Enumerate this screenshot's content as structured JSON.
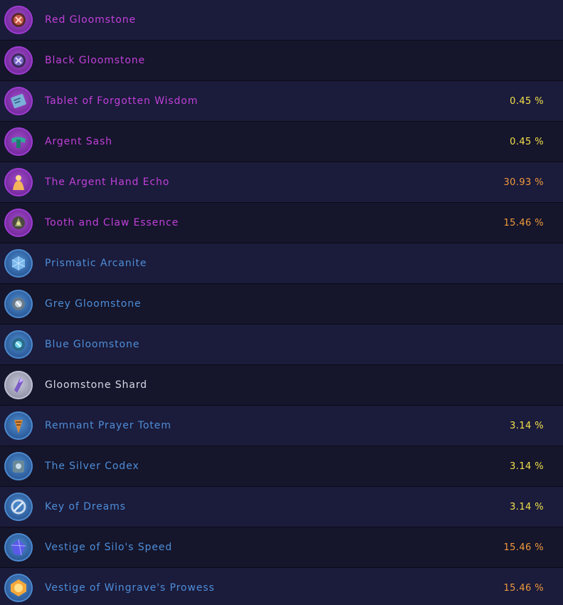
{
  "items": [
    {
      "name": "Red Gloomstone",
      "rarity": "purple",
      "icon": "red-gloomstone-icon",
      "chance": "",
      "chance_color": ""
    },
    {
      "name": "Black Gloomstone",
      "rarity": "purple",
      "icon": "black-gloomstone-icon",
      "chance": "",
      "chance_color": ""
    },
    {
      "name": "Tablet of Forgotten Wisdom",
      "rarity": "purple",
      "icon": "tablet-icon",
      "chance": "0.45 %",
      "chance_color": "yellow"
    },
    {
      "name": "Argent Sash",
      "rarity": "purple",
      "icon": "sash-icon",
      "chance": "0.45 %",
      "chance_color": "yellow"
    },
    {
      "name": "The Argent Hand Echo",
      "rarity": "purple",
      "icon": "echo-figure-icon",
      "chance": "30.93 %",
      "chance_color": "orange"
    },
    {
      "name": "Tooth and Claw Essence",
      "rarity": "purple",
      "icon": "claw-essence-icon",
      "chance": "15.46 %",
      "chance_color": "orange"
    },
    {
      "name": "Prismatic Arcanite",
      "rarity": "blue",
      "icon": "arcanite-cube-icon",
      "chance": "",
      "chance_color": ""
    },
    {
      "name": "Grey Gloomstone",
      "rarity": "blue",
      "icon": "grey-gloomstone-icon",
      "chance": "",
      "chance_color": ""
    },
    {
      "name": "Blue Gloomstone",
      "rarity": "blue",
      "icon": "blue-gloomstone-icon",
      "chance": "",
      "chance_color": ""
    },
    {
      "name": "Gloomstone Shard",
      "rarity": "white",
      "icon": "shard-icon",
      "chance": "",
      "chance_color": ""
    },
    {
      "name": "Remnant Prayer Totem",
      "rarity": "blue",
      "icon": "totem-icon",
      "chance": "3.14 %",
      "chance_color": "yellow"
    },
    {
      "name": "The Silver Codex",
      "rarity": "blue",
      "icon": "codex-icon",
      "chance": "3.14 %",
      "chance_color": "yellow"
    },
    {
      "name": "Key of Dreams",
      "rarity": "blue",
      "icon": "key-icon",
      "chance": "3.14 %",
      "chance_color": "yellow"
    },
    {
      "name": "Vestige of Silo's Speed",
      "rarity": "blue",
      "icon": "vestige-speed-icon",
      "chance": "15.46 %",
      "chance_color": "orange"
    },
    {
      "name": "Vestige of Wingrave's Prowess",
      "rarity": "blue",
      "icon": "vestige-prowess-icon",
      "chance": "15.46 %",
      "chance_color": "orange"
    }
  ],
  "colors": {
    "purple": "#c040d8",
    "blue": "#4e8ed8",
    "white": "#d8d8e6",
    "yellow": "#f2e04a",
    "orange": "#f09a3c",
    "row_odd": "#1b1b3b",
    "row_even": "#15152b"
  }
}
